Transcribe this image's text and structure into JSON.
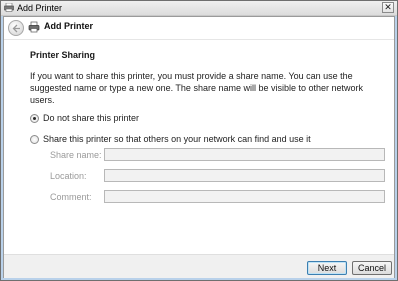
{
  "window": {
    "title": "Add Printer",
    "close_glyph": "✕"
  },
  "nav": {
    "wizard_title": "Add Printer"
  },
  "page": {
    "section_title": "Printer Sharing",
    "description": "If you want to share this printer, you must provide a share name. You can use the suggested name or type a new one. The share name will be visible to other network users."
  },
  "options": {
    "do_not_share": {
      "label": "Do not share this printer",
      "checked": true
    },
    "share": {
      "label": "Share this printer so that others on your network can find and use it",
      "checked": false
    }
  },
  "fields": {
    "share_name": {
      "label": "Share name:",
      "value": ""
    },
    "location": {
      "label": "Location:",
      "value": ""
    },
    "comment": {
      "label": "Comment:",
      "value": ""
    }
  },
  "buttons": {
    "next": "Next",
    "cancel": "Cancel"
  },
  "icons": {
    "app": "printer-icon",
    "back": "back-arrow-icon",
    "wizard": "printer-icon",
    "close": "close-icon"
  }
}
